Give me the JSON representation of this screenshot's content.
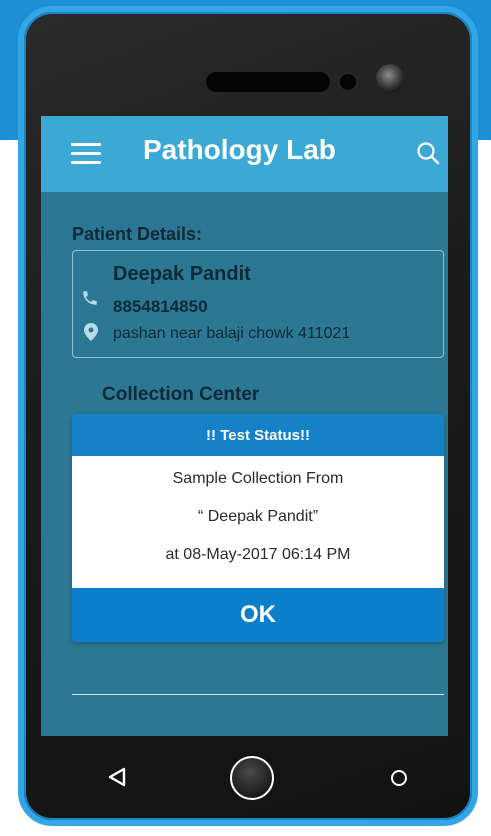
{
  "app": {
    "title": "Pathology Lab"
  },
  "patient": {
    "section_label": "Patient Details:",
    "name": "Deepak Pandit",
    "phone": "8854814850",
    "address": "pashan near balaji chowk 411021"
  },
  "collection": {
    "label": "Collection Center"
  },
  "dialog": {
    "title": "!! Test Status!!",
    "line1": "Sample Collection From",
    "line2": "“ Deepak Pandit”",
    "line3": "at 08-May-2017 06:14 PM",
    "ok_label": "OK"
  },
  "icons": {
    "menu": "hamburger-menu-icon",
    "search": "search-icon",
    "phone": "phone-icon",
    "location": "location-pin-icon",
    "back": "back-triangle-icon",
    "home": "home-circle-icon",
    "recent": "recent-apps-icon"
  },
  "colors": {
    "app_bar": "#3ba9d4",
    "screen_bg": "#2c7894",
    "dialog_header": "#1582c7",
    "ok_button": "#0b7fca",
    "phone_border": "#33a6e6",
    "background_band": "#1c8fd6"
  }
}
